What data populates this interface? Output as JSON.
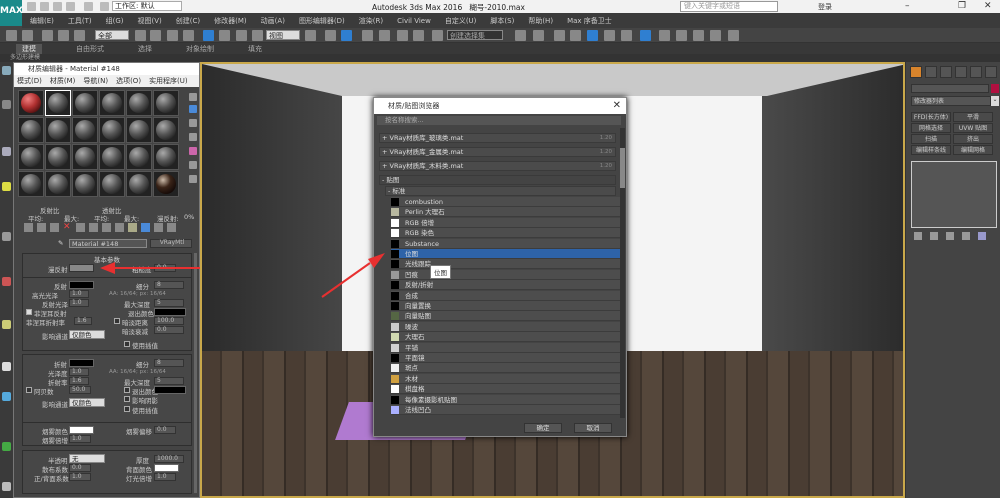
{
  "app": {
    "title": "Autodesk 3ds Max 2016",
    "file": "糊号-2010.max",
    "logo": "MAX",
    "workspace": "工作区: 默认",
    "search_placeholder": "键入关键字或短语",
    "user": "登录"
  },
  "menu": [
    "编辑(E)",
    "工具(T)",
    "组(G)",
    "视图(V)",
    "创建(C)",
    "修改器(M)",
    "动画(A)",
    "图形编辑器(D)",
    "渲染(R)",
    "Civil View",
    "自定义(U)",
    "脚本(S)",
    "帮助(H)",
    "Max 序备卫士"
  ],
  "toolbar": {
    "filter": "全部",
    "view": "视图",
    "selection_set": "创建选择集"
  },
  "ribbon": {
    "tabs": [
      "建模",
      "自由形式",
      "选择",
      "对象绘制",
      "填充"
    ],
    "subtitle": "多边形建模"
  },
  "material_editor": {
    "title": "材质编辑器 - Material #148",
    "menu": [
      "模式(D)",
      "材质(M)",
      "导航(N)",
      "选项(O)",
      "实用程序(U)"
    ],
    "material_name": "Material #148",
    "material_type": "VRayMtl",
    "stats": {
      "reflect_label": "反射比",
      "refract_label": "透射比",
      "avg": "平均:",
      "max": "最大:",
      "scatter": "漫反射:",
      "pct": "0%"
    },
    "rollout": "基本参数",
    "diffuse": "漫反射",
    "roughness": "粗糙度",
    "roughness_val": "0.0",
    "reflect": {
      "label": "反射",
      "subdiv": "细分",
      "subdiv_val": "8",
      "hilight": "高光光泽",
      "hilight_val": "1.0",
      "aa": "AA: 16/64; px: 16/64",
      "gloss": "反射光泽",
      "gloss_val": "1.0",
      "maxdepth": "最大深度",
      "maxdepth_val": "5",
      "fresnel": "菲涅耳反射",
      "exit": "退出颜色",
      "fresnel_ior": "菲涅耳折射率",
      "fresnel_ior_val": "1.6",
      "dim_dist": "暗淡距离",
      "dim_dist_val": "100.0",
      "dim_falloff": "暗淡衰减",
      "dim_falloff_val": "0.0",
      "affect": "影响通道",
      "affect_val": "仅颜色",
      "interp": "使用插值"
    },
    "refract": {
      "label": "折射",
      "subdiv": "细分",
      "subdiv_val": "8",
      "gloss": "光泽度",
      "gloss_val": "1.0",
      "aa": "AA: 16/64; px: 16/64",
      "ior": "折射率",
      "ior_val": "1.6",
      "maxdepth": "最大深度",
      "maxdepth_val": "5",
      "abbe": "阿贝数",
      "abbe_val": "50.0",
      "exit": "退出颜色",
      "shadows": "影响阴影",
      "affect": "影响通道",
      "affect_val": "仅颜色",
      "interp": "使用插值"
    },
    "fog": {
      "color": "烟雾颜色",
      "bias": "烟雾偏移",
      "bias_val": "0.0",
      "mult": "烟雾倍增",
      "mult_val": "1.0"
    },
    "translucency": {
      "label": "半透明",
      "val": "无",
      "thickness": "厚度",
      "thickness_val": "1000.0",
      "scatter": "散布系数",
      "scatter_val": "0.0",
      "back": "背面颜色",
      "fb": "正/背面系数",
      "fb_val": "1.0",
      "light": "灯光倍增",
      "light_val": "1.0"
    }
  },
  "browser": {
    "title": "材质/贴图浏览器",
    "search": "按名称搜索...",
    "libraries": [
      {
        "label": "+ VRay材质库_玻璃类.mat",
        "n": "1.20"
      },
      {
        "label": "+ VRay材质库_金属类.mat",
        "n": "1.20"
      },
      {
        "label": "+ VRay材质库_木料类.mat",
        "n": "1.20"
      }
    ],
    "maps_group": "- 贴图",
    "std_group": "- 标准",
    "items": [
      {
        "label": "combustion",
        "color": "#000000"
      },
      {
        "label": "Perlin 大理石",
        "color": "#b8b8a0"
      },
      {
        "label": "RGB 倍增",
        "color": "#ffffff"
      },
      {
        "label": "RGB 染色",
        "color": "#ffffff"
      },
      {
        "label": "Substance",
        "color": "#000000"
      },
      {
        "label": "位图",
        "color": "#000000"
      },
      {
        "label": "光线跟踪",
        "color": "#000000"
      },
      {
        "label": "凹痕",
        "color": "#999999"
      },
      {
        "label": "反射/折射",
        "color": "#000000"
      },
      {
        "label": "合成",
        "color": "#000000"
      },
      {
        "label": "向量置换",
        "color": "#000000"
      },
      {
        "label": "向量贴图",
        "color": "#556644"
      },
      {
        "label": "噪波",
        "color": "#cccccc"
      },
      {
        "label": "大理石",
        "color": "#d0d8b0"
      },
      {
        "label": "平铺",
        "color": "#d0d0d0"
      },
      {
        "label": "平面镜",
        "color": "#000000"
      },
      {
        "label": "斑点",
        "color": "#f0f0f0"
      },
      {
        "label": "木材",
        "color": "#d0a040"
      },
      {
        "label": "棋盘格",
        "color": "#ffffff"
      },
      {
        "label": "每像素摄影机贴图",
        "color": "#000000"
      },
      {
        "label": "法线凹凸",
        "color": "#aab0ff"
      }
    ],
    "tooltip": "位图",
    "ok": "确定",
    "cancel": "取消"
  },
  "command_panel": {
    "modifier_list": "修改器列表",
    "buttons": [
      "FFD(长方体)",
      "平滑",
      "网格选择",
      "UVW 贴图",
      "扫描",
      "挤出",
      "编辑样条线",
      "编辑网格"
    ]
  },
  "colors": {
    "accent": "#2f7fd1",
    "selected_row": "#2e63a8",
    "viewport_border": "#c9a84a",
    "arrow": "#e83030"
  }
}
